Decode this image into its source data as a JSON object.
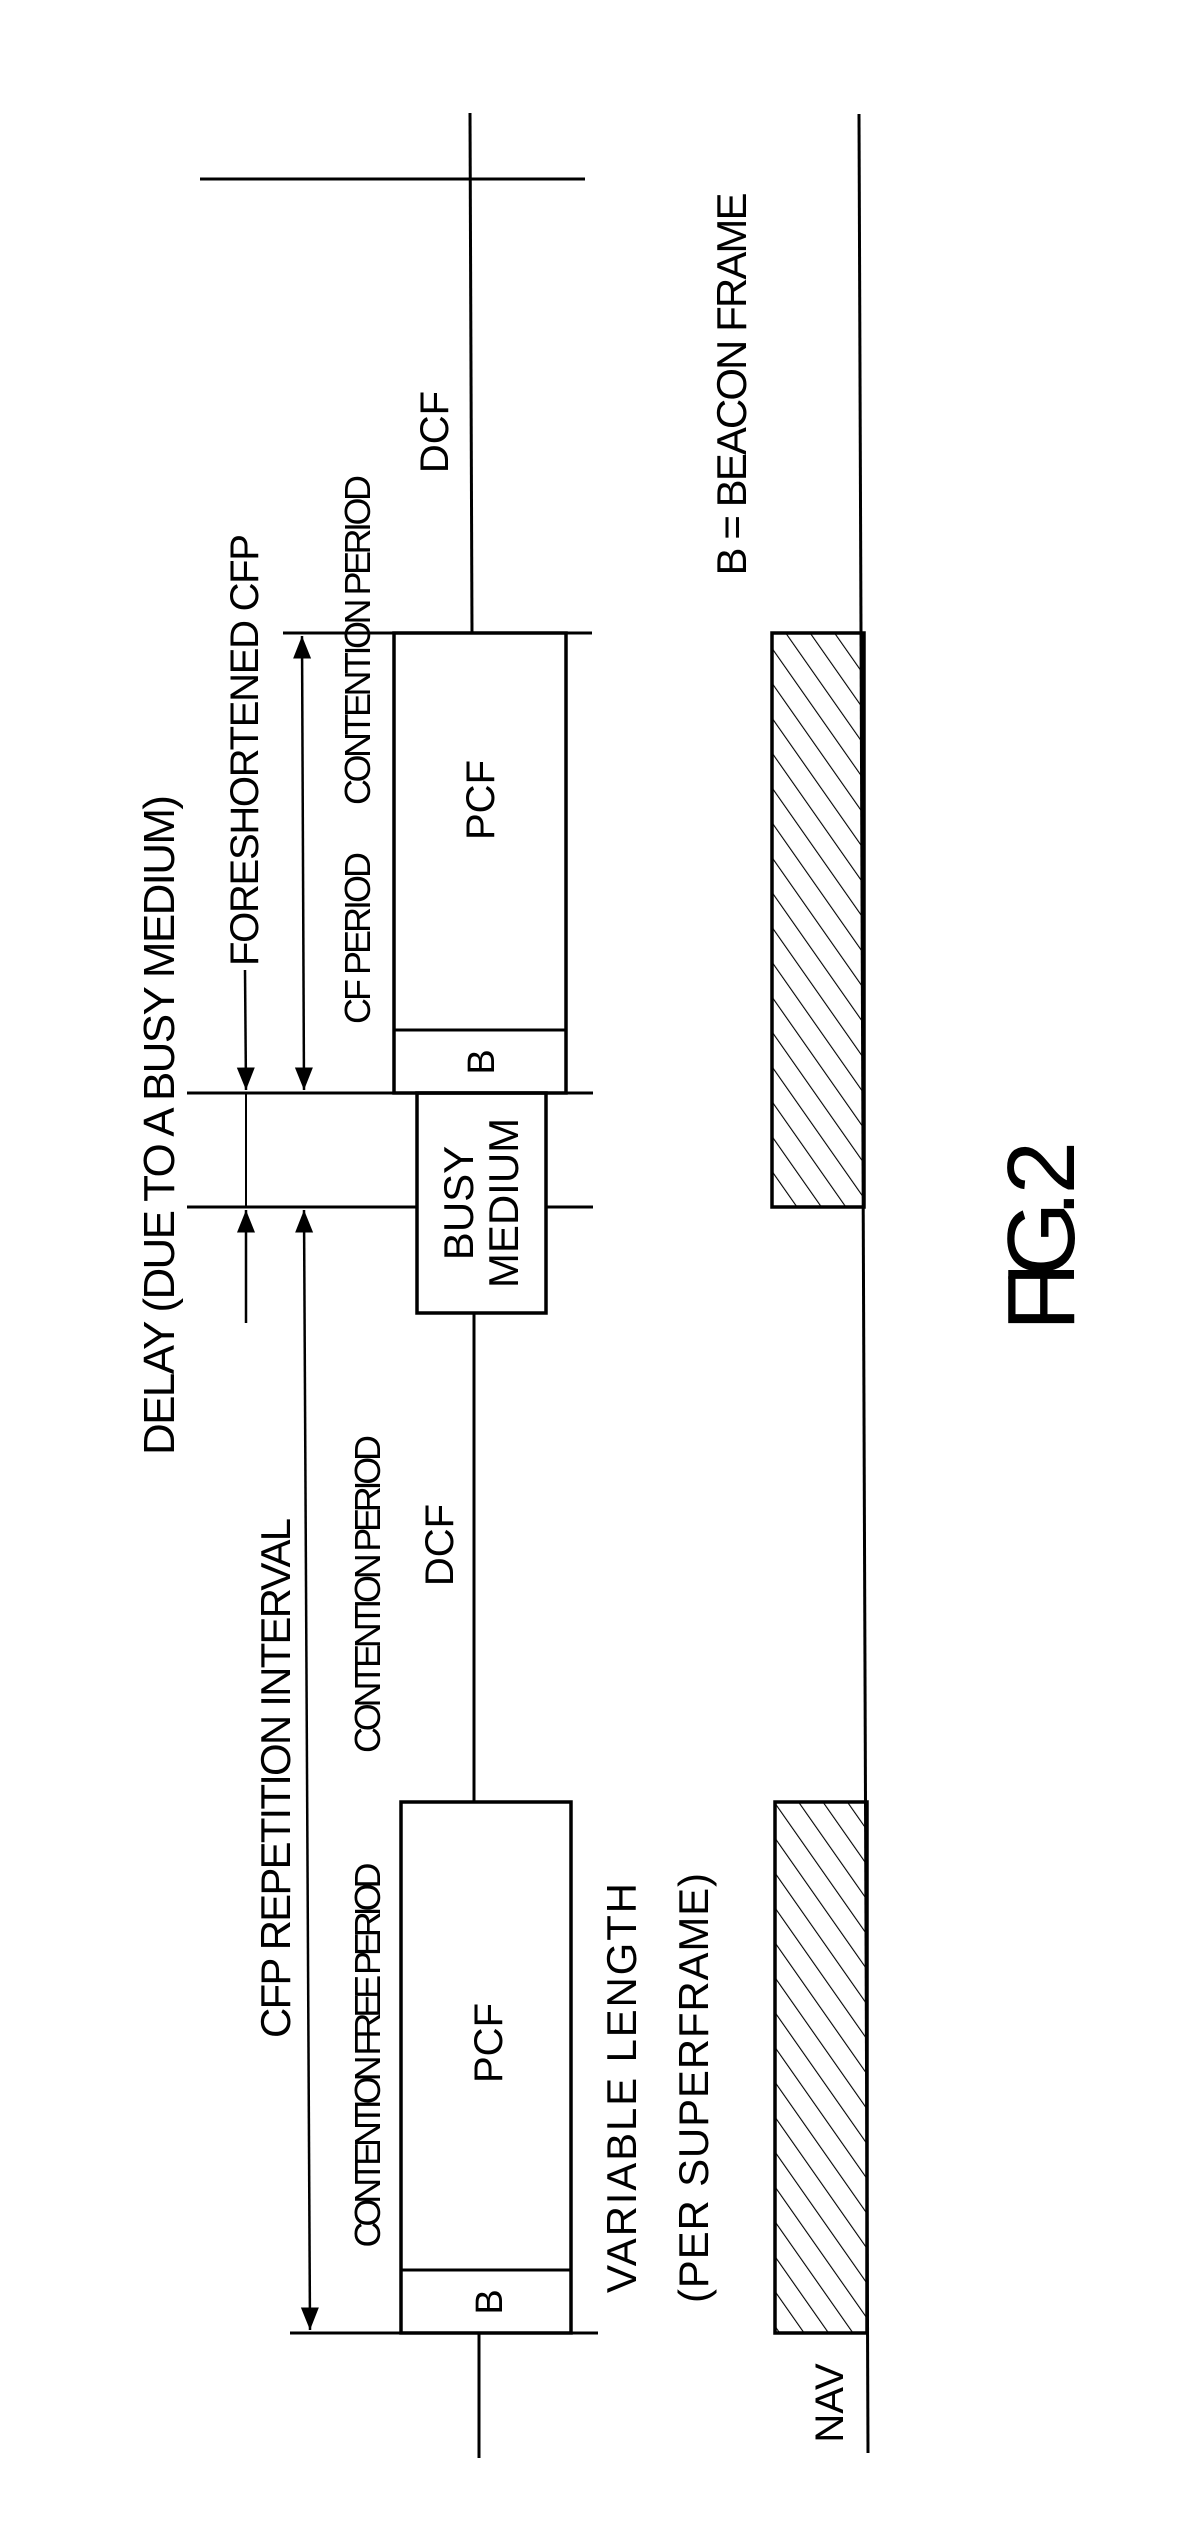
{
  "figure": {
    "title": "FIG. 2",
    "legend": "B = BEACON FRAME",
    "nav_label": "NAV",
    "hatch_color": "#000000",
    "line_color": "#000000",
    "background": "#ffffff"
  },
  "labels": {
    "cfp_repetition_interval": "CFP REPETITION INTERVAL",
    "delay": "DELAY (DUE TO A BUSY MEDIUM)",
    "foreshortened_cfp": "FORESHORTENED CFP",
    "contention_free_period": "CONTENTION FREE PERIOD",
    "contention_period_1": "CONTENTION  PERIOD",
    "cf_period": "CF PERIOD",
    "contention_period_2": "CONTENTION  PERIOD",
    "dcf_1": "DCF",
    "dcf_2": "DCF",
    "variable_length": "VARIABLE LENGTH",
    "per_superframe": "(PER SUPERFRAME)"
  },
  "blocks": {
    "superframe_1": {
      "beacon": "B",
      "pcf": "PCF"
    },
    "busy_medium": {
      "line1": "BUSY",
      "line2": "MEDIUM"
    },
    "superframe_2": {
      "beacon": "B",
      "pcf": "PCF"
    }
  }
}
